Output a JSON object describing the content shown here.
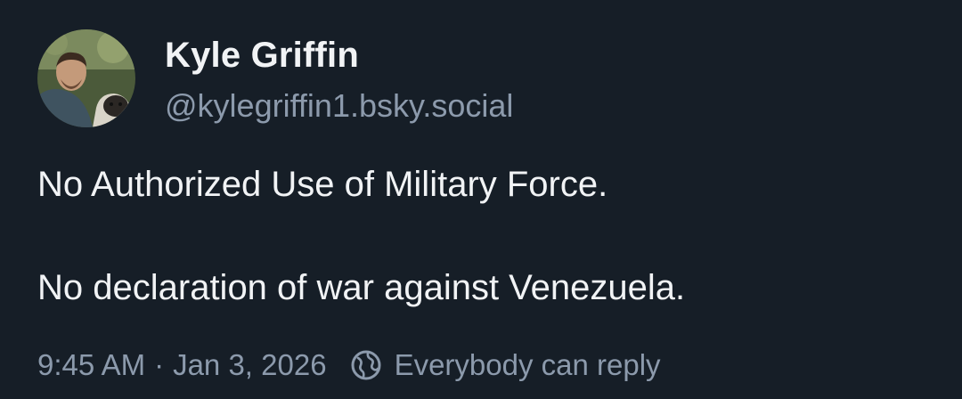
{
  "author": {
    "display_name": "Kyle Griffin",
    "handle": "@kylegriffin1.bsky.social"
  },
  "post": {
    "lines": [
      "No Authorized Use of Military Force.",
      "No declaration of war against Venezuela."
    ]
  },
  "meta": {
    "time": "9:45 AM",
    "separator": "·",
    "date": "Jan 3, 2026",
    "reply_setting": "Everybody can reply",
    "reply_icon": "globe-icon"
  },
  "colors": {
    "background": "#161e27",
    "primary_text": "#f1f3f5",
    "secondary_text": "#8c9aac"
  }
}
